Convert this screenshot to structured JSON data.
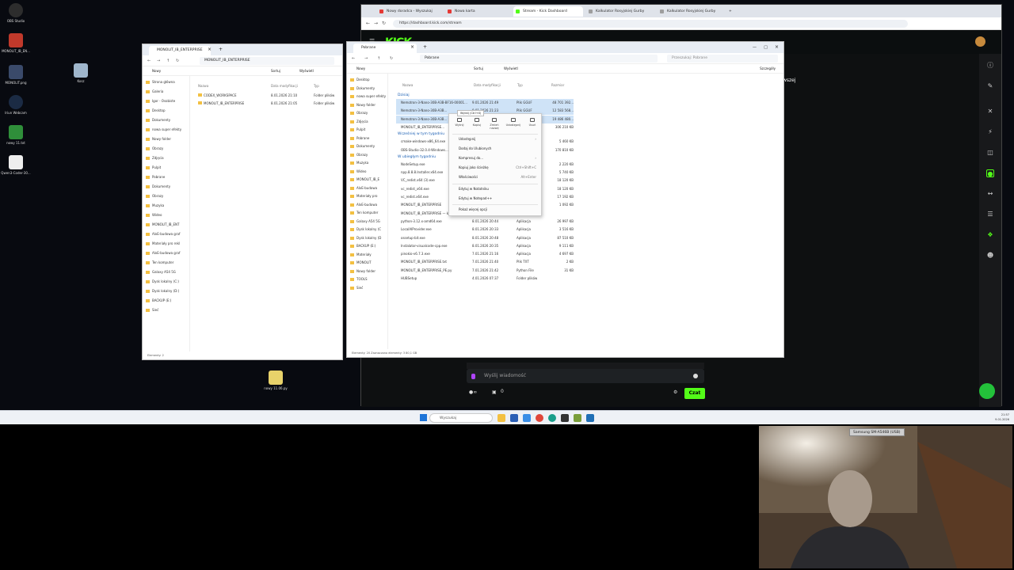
{
  "desktop": {
    "icons": [
      {
        "name": "OBS Studio",
        "color": "#2d2d2d"
      },
      {
        "name": "MONOLIT_IB_EN...",
        "color": "#c0392b"
      },
      {
        "name": "MONOLIT.png",
        "color": "#3a4a6a"
      },
      {
        "name": "Iriun Webcam",
        "color": "#1b2b44"
      },
      {
        "name": "nowy 11.txt",
        "color": "#2f8f3a"
      },
      {
        "name": "Qwen3-Coder-30...",
        "color": "#eeeeee"
      },
      {
        "name": "Kosz",
        "color": "#9fb6cc"
      },
      {
        "name": "nowy 11.06.py",
        "color": "#e8d26a"
      }
    ]
  },
  "browser": {
    "tabs": [
      {
        "label": "Nowy doradca - Wyszukaj",
        "color": "#e53935"
      },
      {
        "label": "Nowa karta",
        "color": "#e53935"
      },
      {
        "label": "Stream - Kick Dashboard",
        "color": "#53fc18"
      },
      {
        "label": "Kalkulator Rosyjskiej Gurby",
        "color": "#9e9e9e"
      },
      {
        "label": "Kalkulator Rosyjskiej Gurby",
        "color": "#9e9e9e"
      }
    ],
    "url": "https://dashboard.kick.com/stream",
    "kick_logo": "KICK",
    "chat_placeholder": "Wyślij wiadomość",
    "chat_button": "Czat",
    "side_text": "wszej",
    "counter": "0"
  },
  "explorer_left": {
    "tab_title": "MONOLIT_IB_ENTERPRISE",
    "breadcrumb": "MONOLIT_IB_ENTERPRISE",
    "cmd": [
      "Nowy",
      "Sortuj",
      "Wyświetl"
    ],
    "columns": [
      "Nazwa",
      "Data modyfikacji",
      "Typ"
    ],
    "rows": [
      {
        "name": "CODEX_WORKSPACE",
        "date": "8.01.2026 21:10",
        "type": "Folder plików"
      },
      {
        "name": "MONOLIT_IB_ENTERPRISE",
        "date": "8.01.2026 21:05",
        "type": "Folder plików"
      }
    ],
    "sidebar": [
      "Strona główna",
      "Galeria",
      "Igor - Osobiste",
      "Desktop",
      "Dokumenty",
      "nowa super efekty",
      "Nowy folder",
      "Obrazy",
      "Zdjęcia",
      "Pulpit",
      "Pobrane",
      "Dokumenty",
      "Obrazy",
      "Muzyka",
      "Wideo",
      "MONOLIT_IB_ENT",
      "AIxE-budowa graf",
      "Materiały pro rekl",
      "AIxE-budowa graf",
      "Ten komputer",
      "Galaxy A54 5G",
      "Dysk lokalny (C:)",
      "Dysk lokalny (D:)",
      "BACKUP (E:)",
      "Sieć"
    ],
    "status": "Elementy: 2"
  },
  "explorer_right": {
    "tab_title": "Pobrane",
    "breadcrumb": "Pobrane",
    "search": "Przeszukaj: Pobrane",
    "cmd": [
      "Nowy",
      "Sortuj",
      "Wyświetl",
      "Szczegóły"
    ],
    "columns": [
      "Nazwa",
      "Data modyfikacji",
      "Typ",
      "Rozmiar"
    ],
    "groups": [
      "Dzisiaj",
      "Wcześniej w tym tygodniu",
      "W ubiegłym tygodniu"
    ],
    "rows": [
      {
        "name": "Nemotron-3-Nano-30B-A3B-BF16-00001...",
        "date": "9.01.2026 21:49",
        "type": "Plik GGUF",
        "size": "48 701 392...",
        "sel": true
      },
      {
        "name": "Nemotron-3-Nano-30B-A3B...",
        "date": "9.01.2026 21:23",
        "type": "Plik GGUF",
        "size": "12 583 568...",
        "sel": true
      },
      {
        "name": "Nemotron-3-Nano-30B-A3B...",
        "date": "9.01.2026 21:11",
        "type": "Plik GGUF",
        "size": "19 486 480...",
        "sel": true
      },
      {
        "name": "MONOLIT_IB_ENTERPRISE...",
        "date": "",
        "type": "",
        "size": "306 210 KB",
        "sel": false
      },
      {
        "name": "cmake-windows-x86_64.exe",
        "date": "",
        "type": "",
        "size": "5 460 KB",
        "sel": false
      },
      {
        "name": "OBS-Studio-32.0.4-Windows...",
        "date": "",
        "type": "",
        "size": "170 810 KB",
        "sel": false
      },
      {
        "name": "NodeSetup.exe",
        "date": "",
        "type": "",
        "size": "2 220 KB",
        "sel": false
      },
      {
        "name": "npp.8.8.8.Installer.x64.exe",
        "date": "",
        "type": "",
        "size": "5 740 KB",
        "sel": false
      },
      {
        "name": "VC_redist.x64 (3).exe",
        "date": "",
        "type": "",
        "size": "18 120 KB",
        "sel": false
      },
      {
        "name": "vc_redist_x64.exe",
        "date": "",
        "type": "",
        "size": "18 120 KB",
        "sel": false
      },
      {
        "name": "vc_redist.x64.exe",
        "date": "",
        "type": "",
        "size": "17 192 KB",
        "sel": false
      },
      {
        "name": "MONOLIT_IB_ENTERPRISE",
        "date": "",
        "type": "",
        "size": "1 092 KB",
        "sel": false
      },
      {
        "name": "MONOLIT_IB_ENTERPRISE — kopia.py",
        "date": "8.01.2026 20:10",
        "type": "Python File",
        "size": "",
        "sel": false
      },
      {
        "name": "python-3.12.x-amd64.exe",
        "date": "8.01.2026 20:44",
        "type": "Aplikacja",
        "size": "26 997 KB",
        "sel": false
      },
      {
        "name": "LocalAIProvider.exe",
        "date": "8.01.2026 20:33",
        "type": "Aplikacja",
        "size": "3 516 KB",
        "sel": false
      },
      {
        "name": "ossetup-bit.exe",
        "date": "8.01.2026 20:48",
        "type": "Aplikacja",
        "size": "87 510 KB",
        "sel": false
      },
      {
        "name": "Instalator-visualcode-cpp.exe",
        "date": "8.01.2026 20:35",
        "type": "Aplikacja",
        "size": "9 111 KB",
        "sel": false
      },
      {
        "name": "pinokio-v6.7.3.exe",
        "date": "7.01.2026 21:16",
        "type": "Aplikacja",
        "size": "4 697 KB",
        "sel": false
      },
      {
        "name": "MONOLIT_IB_ENTERPRISE.txt",
        "date": "7.01.2026 21:40",
        "type": "Plik TXT",
        "size": "2 KB",
        "sel": false
      },
      {
        "name": "MONOLIT_IB_ENTERPRISE_PE.py",
        "date": "7.01.2026 21:42",
        "type": "Python File",
        "size": "31 KB",
        "sel": false
      },
      {
        "name": "HUBSetup",
        "date": "4.01.2026 07:37",
        "type": "Folder plików",
        "size": "",
        "sel": false
      }
    ],
    "sidebar": [
      "Desktop",
      "Dokumenty",
      "nowa super efekty",
      "Nowy folder",
      "Obrazy",
      "Zdjęcia",
      "Pulpit",
      "Pobrane",
      "Dokumenty",
      "Obrazy",
      "Muzyka",
      "Wideo",
      "MONOLIT_IB_E",
      "AIxE-budowa",
      "Materiały pro",
      "AIxE-budowa",
      "Ten komputer",
      "Galaxy A54 5G",
      "Dysk lokalny (C",
      "Dysk lokalny (D",
      "BACKUP (E:)",
      "Materiały",
      "MONOLIT",
      "Nowy folder",
      "TOOLS",
      "Sieć"
    ],
    "status": "Elementy: 20   Zaznaczono elementy: 3   80,1 GB"
  },
  "context_menu": {
    "icon_row": [
      "Wytnij",
      "Kopiuj",
      "Zmień nazwę",
      "Udostępnij",
      "Usuń"
    ],
    "tooltip": "Wytnij (Ctrl+X)",
    "items": [
      {
        "label": "Udostępnij",
        "shortcut": ""
      },
      {
        "label": "Dodaj do Ulubionych",
        "shortcut": ""
      },
      {
        "label": "Kompresuj do...",
        "shortcut": ""
      },
      {
        "label": "Kopiuj jako ścieżkę",
        "shortcut": "Ctrl+Shift+C"
      },
      {
        "label": "Właściwości",
        "shortcut": "Alt+Enter"
      },
      {
        "label": "Edytuj w Notatniku",
        "shortcut": ""
      },
      {
        "label": "Edytuj w Notepad++",
        "shortcut": ""
      },
      {
        "label": "Pokaż więcej opcji",
        "shortcut": ""
      }
    ]
  },
  "taskbar": {
    "search": "Wyszukaj",
    "time": "21:57",
    "date": "9.01.2026"
  },
  "webcam": {
    "label": "Samsung SM-A546B (USB)"
  }
}
